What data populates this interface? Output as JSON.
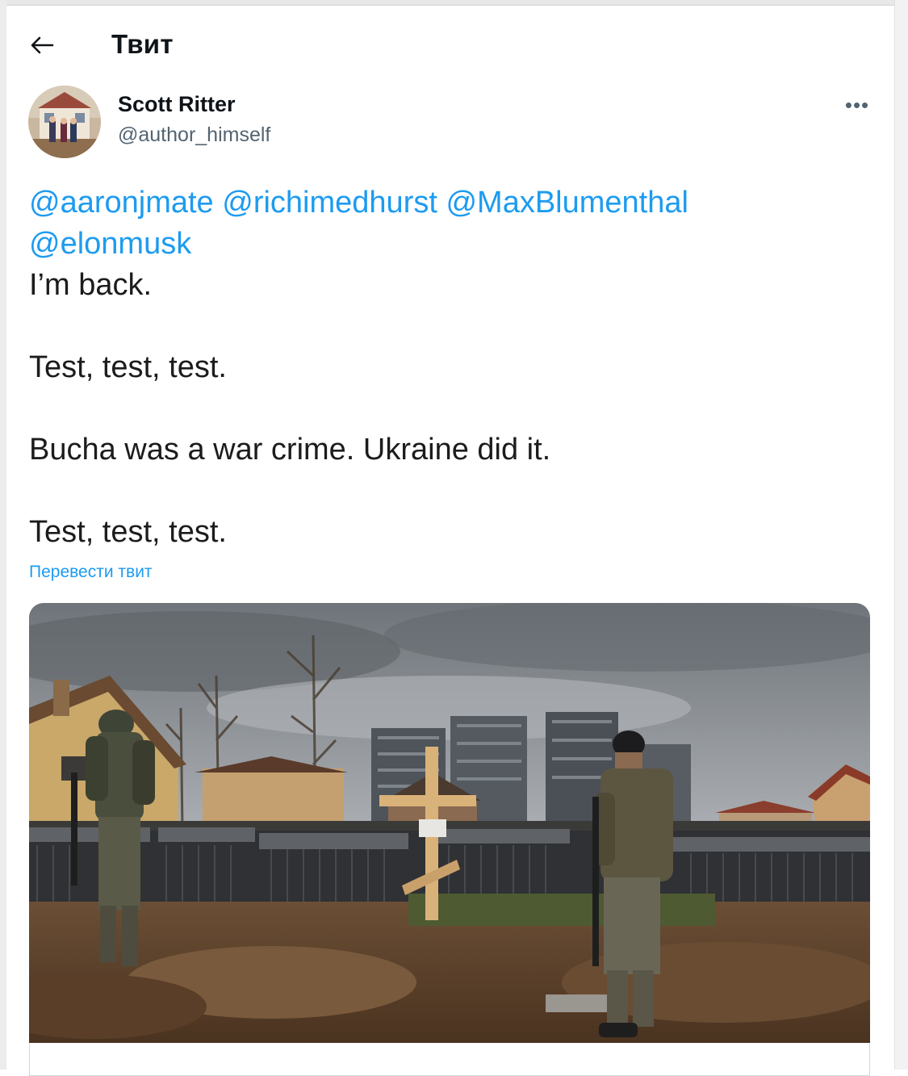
{
  "header": {
    "back_icon": "arrow-left-icon",
    "title": "Твит"
  },
  "tweet": {
    "author": {
      "name": "Scott Ritter",
      "handle": "@author_himself"
    },
    "more_icon": "more-horizontal-icon",
    "mentions": [
      "@aaronjmate",
      "@richimedhurst",
      "@MaxBlumenthal",
      "@elonmusk"
    ],
    "lines": [
      "I’m back.",
      "Test, test, test.",
      "Bucha was a war crime. Ukraine did it.",
      "Test, test, test."
    ],
    "translate_label": "Перевести твит",
    "media_description": "photo"
  },
  "colors": {
    "link": "#1d9bf0",
    "text": "#0f1419",
    "muted": "#536471"
  }
}
